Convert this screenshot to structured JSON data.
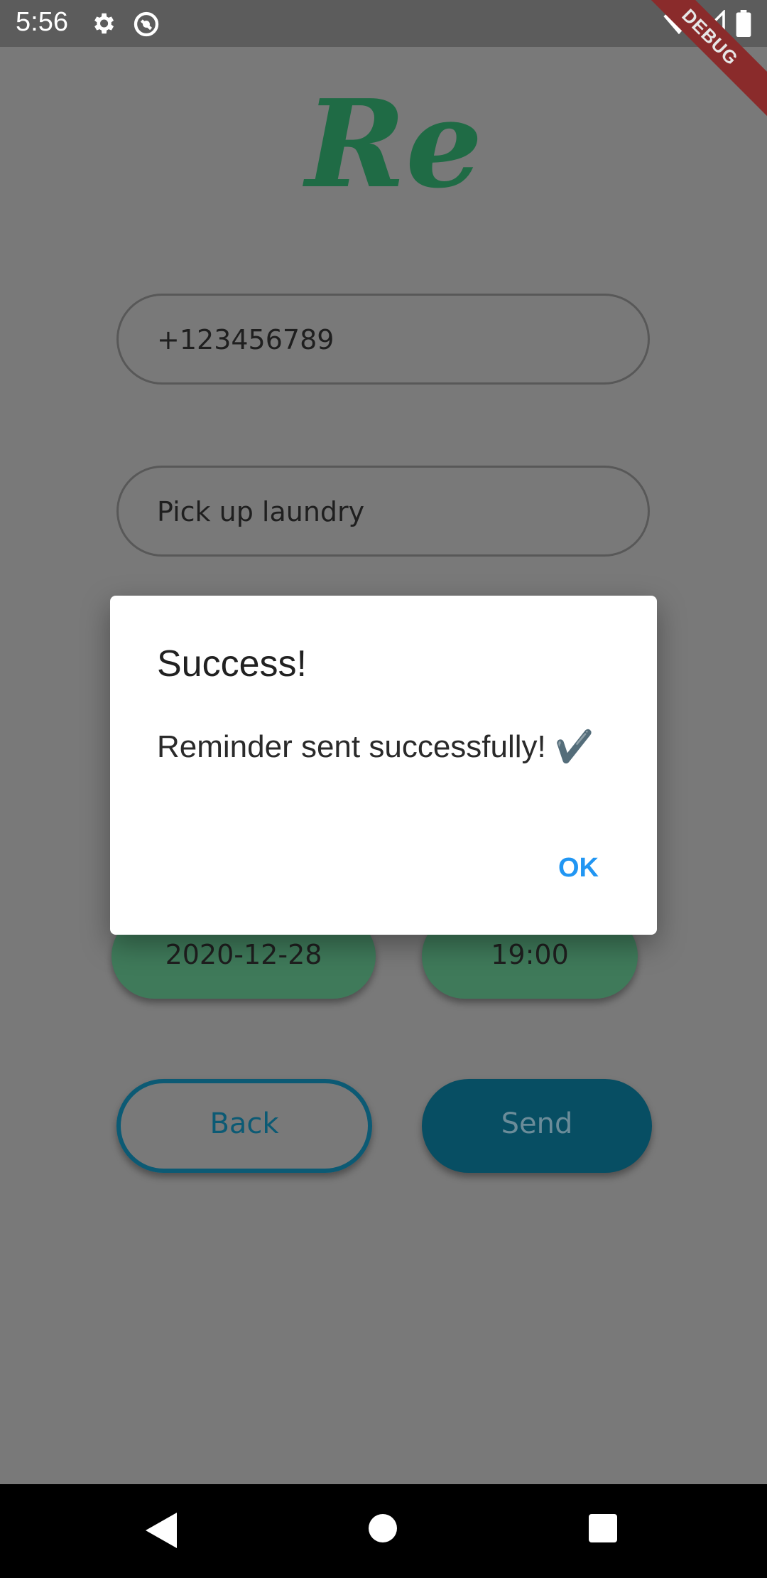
{
  "status_bar": {
    "time": "5:56",
    "icons": [
      "gear-icon",
      "sync-icon",
      "wifi-icon",
      "signal-icon",
      "battery-icon"
    ],
    "debug_label": "DEBUG"
  },
  "logo": {
    "text": "Re",
    "color": "#1f6b45"
  },
  "form": {
    "phone_value": "+123456789",
    "reminder_value": "Pick up laundry",
    "date_value": "2020-12-28",
    "time_value": "19:00"
  },
  "actions": {
    "back_label": "Back",
    "send_label": "Send"
  },
  "dialog": {
    "title": "Success!",
    "message": "Reminder sent successfully! ✔️",
    "ok_label": "OK",
    "ok_color": "#2196f3"
  },
  "nav_bar": {
    "icons": [
      "back-icon",
      "home-icon",
      "recents-icon"
    ]
  }
}
